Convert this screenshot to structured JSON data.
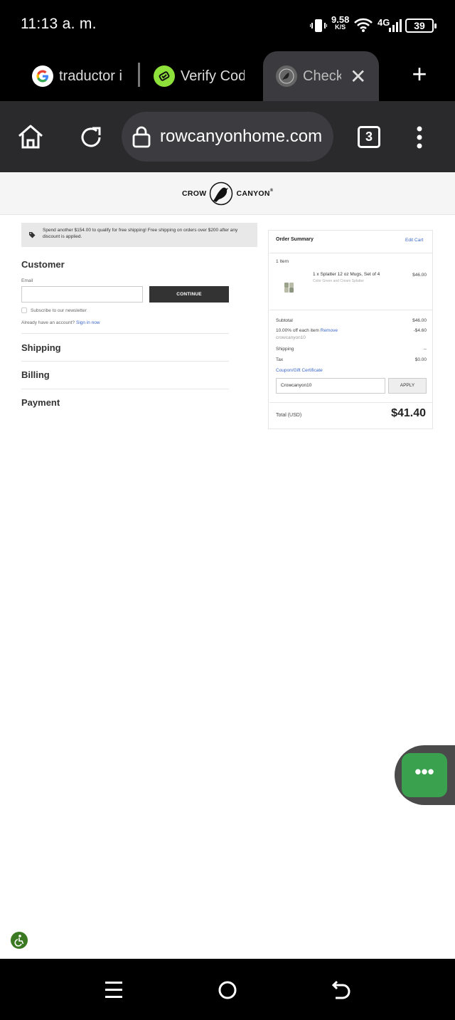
{
  "status_bar": {
    "time": "11:13 a. m.",
    "net_speed_value": "9.58",
    "net_speed_unit": "K/S",
    "network": "4G",
    "battery": "39"
  },
  "tabs": [
    {
      "label": "traductor i",
      "icon": "google-icon"
    },
    {
      "label": "Verify Cod",
      "icon": "verify-icon"
    },
    {
      "label": "Check",
      "icon": "crow-canyon-favicon",
      "active": true
    }
  ],
  "toolbar": {
    "url": "rowcanyonhome.com",
    "tab_count": "3"
  },
  "site": {
    "logo_left": "CROW",
    "logo_right": "CANYON",
    "logo_mark": "®"
  },
  "promo": {
    "text": "Spend another $154.00 to qualify for free shipping! Free shipping on orders over $200 after any discount is applied."
  },
  "checkout": {
    "customer_heading": "Customer",
    "email_label": "Email",
    "email_value": "",
    "continue_label": "CONTINUE",
    "newsletter_label": "Subscribe to our newsletter",
    "account_prompt": "Already have an account?",
    "signin_label": "Sign in now",
    "shipping_heading": "Shipping",
    "billing_heading": "Billing",
    "payment_heading": "Payment"
  },
  "summary": {
    "title": "Order Summary",
    "edit_cart": "Edit Cart",
    "item_count": "1 Item",
    "item_name": "1 x Splatter 12 oz Mugs, Set of 4",
    "item_variant": "Color Green and Cream Splatter",
    "item_price": "$46.00",
    "subtotal_label": "Subtotal",
    "subtotal_value": "$46.00",
    "discount_label": "10.00% off each item",
    "discount_remove": "Remove",
    "discount_code": "crowcanyon10",
    "discount_value": "-$4.60",
    "shipping_label": "Shipping",
    "shipping_value": "--",
    "tax_label": "Tax",
    "tax_value": "$0.00",
    "coupon_link": "Coupon/Gift Certificate",
    "coupon_value": "Crowcanyon10",
    "apply_label": "APPLY",
    "total_label": "Total (USD)",
    "total_value": "$41.40"
  },
  "chat": {
    "label": "•••"
  },
  "colors": {
    "link": "#3a66c8",
    "chat_green": "#3aa14f",
    "button_dark": "#333333",
    "a11y_green": "#3b7a22"
  }
}
